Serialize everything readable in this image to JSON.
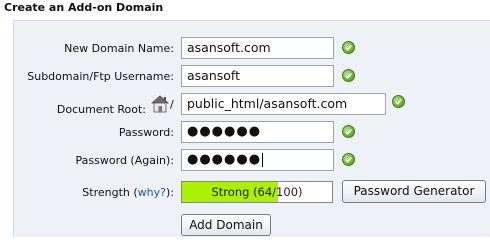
{
  "title": "Create an Add-on Domain",
  "fields": {
    "new_domain": {
      "label": "New Domain Name:",
      "value": "asansoft.com"
    },
    "subdomain": {
      "label": "Subdomain/Ftp Username:",
      "value": "asansoft"
    },
    "document_root": {
      "label": "Document Root:",
      "prefix": "/",
      "value": "public_html/asansoft.com"
    },
    "password": {
      "label": "Password:",
      "value": "●●●●●●"
    },
    "password_again": {
      "label": "Password (Again):",
      "value": "●●●●●●"
    }
  },
  "strength": {
    "label_prefix": "Strength (",
    "why_link": "why?",
    "label_suffix": "):",
    "text": "Strong (64/100)",
    "score": 64,
    "max": 100,
    "fill_color": "#aaf000"
  },
  "buttons": {
    "password_generator": "Password Generator",
    "add_domain": "Add Domain"
  },
  "icons": {
    "valid": "check-circle-icon",
    "home": "home-icon"
  }
}
